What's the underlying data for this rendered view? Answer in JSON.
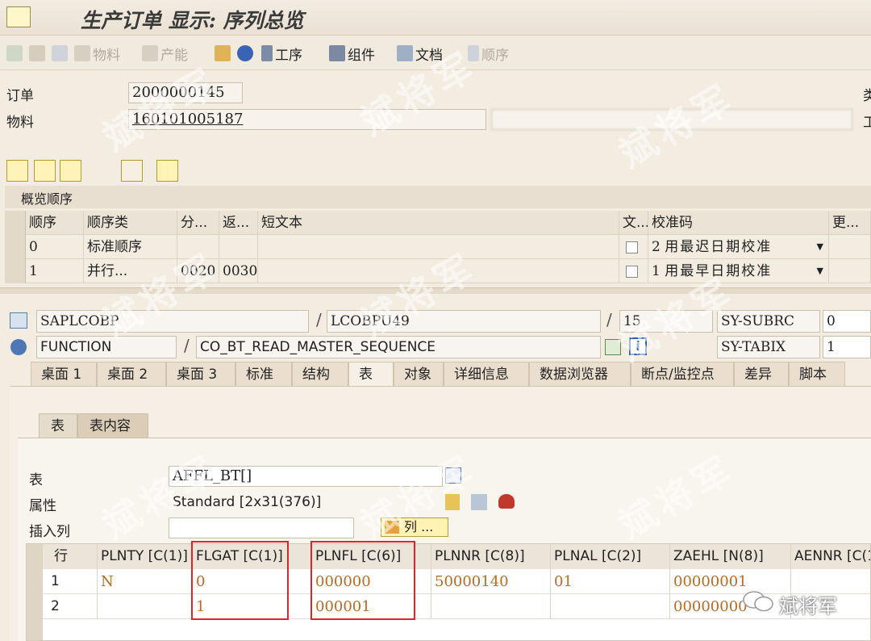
{
  "window": {
    "title": "生产订单 显示: 序列总览"
  },
  "toolbar": {
    "material_label": "物料",
    "capacity_label": "产能",
    "operations_label": "工序",
    "components_label": "组件",
    "documents_label": "文档",
    "sequences_label": "顺序"
  },
  "header": {
    "order_label": "订单",
    "order_value": "2000000145",
    "material_label": "物料",
    "material_value": "160101005187",
    "right_label_1": "类",
    "right_label_2": "工"
  },
  "overview": {
    "title": "概览顺序",
    "columns": [
      "顺序",
      "顺序类",
      "分...",
      "返...",
      "短文本",
      "文...",
      "校准码",
      "更..."
    ],
    "rows": [
      {
        "seq": "0",
        "type": "标准顺序",
        "branch": "",
        "return": "",
        "text": "",
        "calib_code": "2",
        "calib_text": "用最迟日期校准"
      },
      {
        "seq": "1",
        "type": "并行...",
        "branch": "0020",
        "return": "0030",
        "text": "",
        "calib_code": "1",
        "calib_text": "用最早日期校准"
      }
    ]
  },
  "debugger": {
    "program": "SAPLCOBP",
    "include": "LCOBPU49",
    "line": "15",
    "subrc_label": "SY-SUBRC",
    "subrc_value": "0",
    "kind": "FUNCTION",
    "name": "CO_BT_READ_MASTER_SEQUENCE",
    "tabix_label": "SY-TABIX",
    "tabix_value": "1",
    "tabs": [
      "桌面 1",
      "桌面 2",
      "桌面 3",
      "标准",
      "结构",
      "表",
      "对象",
      "详细信息",
      "数据浏览器",
      "断点/监控点",
      "差异",
      "脚本"
    ],
    "subtabs": [
      "表",
      "表内容"
    ]
  },
  "table_view": {
    "table_label": "表",
    "table_value": "AFFL_BT[]",
    "attr_label": "属性",
    "attr_value": "Standard [2x31(376)]",
    "insert_label": "插入列",
    "insert_value": "",
    "columns_button": "列 ...",
    "grid_columns": [
      "行",
      "PLNTY [C(1)]",
      "FLGAT [C(1)]",
      "PLNFL [C(6)]",
      "PLNNR [C(8)]",
      "PLNAL [C(2)]",
      "ZAEHL [N(8)]",
      "AENNR [C(1"
    ],
    "grid_rows": [
      {
        "row": "1",
        "PLNTY": "N",
        "FLGAT": "0",
        "PLNFL": "000000",
        "PLNNR": "50000140",
        "PLNAL": "01",
        "ZAEHL": "00000001"
      },
      {
        "row": "2",
        "PLNTY": "",
        "FLGAT": "1",
        "PLNFL": "000001",
        "PLNNR": "",
        "PLNAL": "",
        "ZAEHL": "00000000"
      }
    ]
  },
  "watermark": {
    "text": "斌将军",
    "brand": "斌将军"
  }
}
